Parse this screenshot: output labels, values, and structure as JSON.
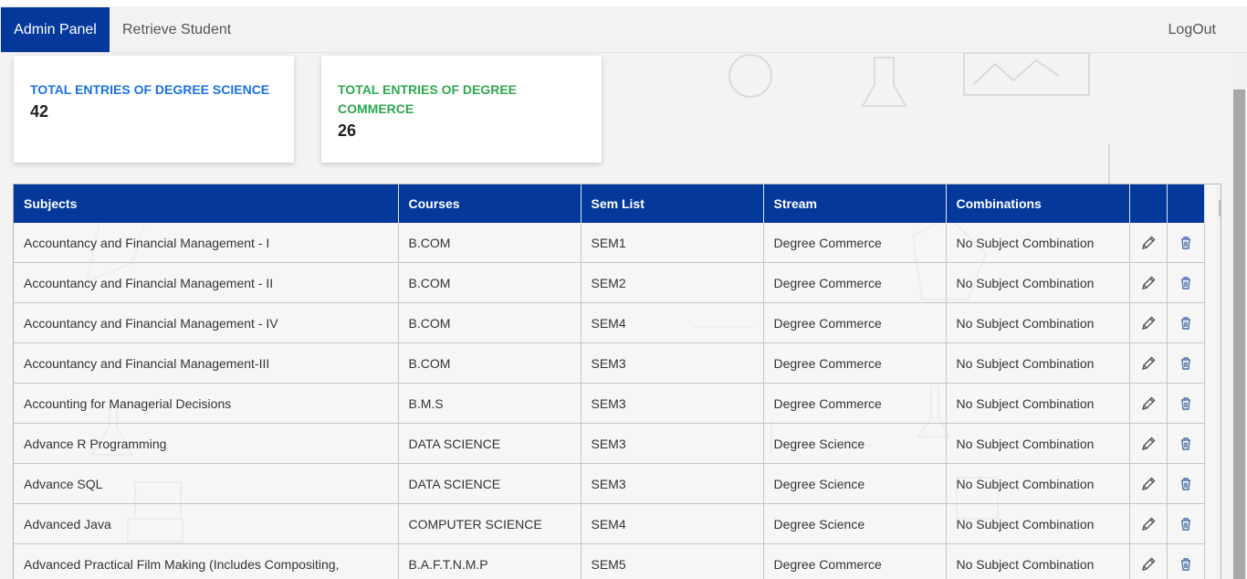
{
  "nav": {
    "admin_panel": "Admin Panel",
    "retrieve_student": "Retrieve Student",
    "logout": "LogOut"
  },
  "cards": {
    "science": {
      "title": "TOTAL ENTRIES OF DEGREE SCIENCE",
      "value": "42"
    },
    "commerce": {
      "title": "TOTAL ENTRIES OF DEGREE COMMERCE",
      "value": "26"
    }
  },
  "table": {
    "headers": [
      "Subjects",
      "Courses",
      "Sem List",
      "Stream",
      "Combinations"
    ],
    "rows": [
      [
        "Accountancy and Financial Management - I",
        "B.COM",
        "SEM1",
        "Degree Commerce",
        "No Subject Combination"
      ],
      [
        "Accountancy and Financial Management - II",
        "B.COM",
        "SEM2",
        "Degree Commerce",
        "No Subject Combination"
      ],
      [
        "Accountancy and Financial Management - IV",
        "B.COM",
        "SEM4",
        "Degree Commerce",
        "No Subject Combination"
      ],
      [
        "Accountancy and Financial Management-III",
        "B.COM",
        "SEM3",
        "Degree Commerce",
        "No Subject Combination"
      ],
      [
        "Accounting for Managerial Decisions",
        "B.M.S",
        "SEM3",
        "Degree Commerce",
        "No Subject Combination"
      ],
      [
        "Advance R Programming",
        "DATA SCIENCE",
        "SEM3",
        "Degree Science",
        "No Subject Combination"
      ],
      [
        "Advance SQL",
        "DATA SCIENCE",
        "SEM3",
        "Degree Science",
        "No Subject Combination"
      ],
      [
        "Advanced Java",
        "COMPUTER SCIENCE",
        "SEM4",
        "Degree Science",
        "No Subject Combination"
      ],
      [
        "Advanced Practical Film Making (Includes Compositing,",
        "B.A.F.T.N.M.P",
        "SEM5",
        "Degree Commerce",
        "No Subject Combination"
      ]
    ]
  },
  "icons": {
    "edit": "pencil-icon",
    "delete": "trash-icon"
  },
  "colors": {
    "primary": "#04399b",
    "science": "#1a73e8",
    "commerce": "#2fa84f"
  }
}
